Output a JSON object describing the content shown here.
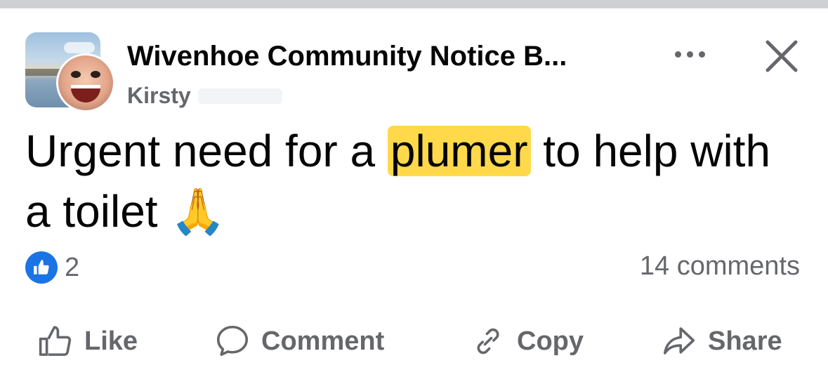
{
  "post": {
    "group_name": "Wivenhoe Community Notice B...",
    "author": "Kirsty",
    "text_before": "Urgent need for a ",
    "text_highlight": "plumer",
    "text_after": " to help with a toilet ",
    "emoji": "🙏"
  },
  "header": {
    "more_icon": "more-icon",
    "close_icon": "close-icon"
  },
  "stats": {
    "reactions_count": "2",
    "comments_label": "14 comments"
  },
  "actions": {
    "like": "Like",
    "comment": "Comment",
    "copy": "Copy",
    "share": "Share"
  },
  "colors": {
    "highlight": "#ffd94a",
    "like_blue": "#1b74e4",
    "secondary_text": "#65676b"
  }
}
